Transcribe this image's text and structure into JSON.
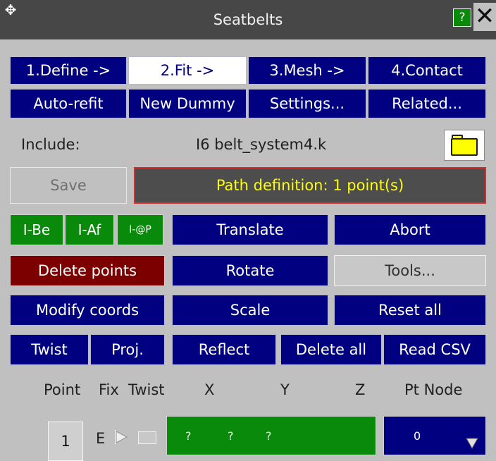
{
  "window": {
    "title": "Seatbelts",
    "pin_glyph": "✥",
    "help_label": "?",
    "close_label": "✕"
  },
  "steps": [
    {
      "label": "1.Define ->",
      "active": false
    },
    {
      "label": "2.Fit ->",
      "active": true
    },
    {
      "label": "3.Mesh ->",
      "active": false
    },
    {
      "label": "4.Contact",
      "active": false
    }
  ],
  "actions_row": {
    "auto_refit": "Auto-refit",
    "new_dummy": "New Dummy",
    "settings": "Settings...",
    "related": "Related..."
  },
  "include": {
    "label": "Include:",
    "value": "I6  belt_system4.k",
    "folder_icon": "folder-icon"
  },
  "save_label": "Save",
  "status_text": "Path definition: 1 point(s)",
  "insert_buttons": {
    "before": "I-Be",
    "after": "I-Af",
    "at": "I-@P"
  },
  "transform": {
    "translate": "Translate",
    "abort": "Abort",
    "delete_points": "Delete points",
    "rotate": "Rotate",
    "tools": "Tools...",
    "modify_coords": "Modify coords",
    "scale": "Scale",
    "reset_all": "Reset all",
    "twist": "Twist",
    "proj": "Proj.",
    "reflect": "Reflect",
    "delete_all": "Delete all",
    "read_csv": "Read CSV"
  },
  "table": {
    "headers": {
      "point": "Point",
      "fix": "Fix",
      "twist": "Twist",
      "x": "X",
      "y": "Y",
      "z": "Z",
      "pt_node": "Pt Node"
    },
    "rows": [
      {
        "point": "1",
        "fix": "E",
        "x": "?",
        "y": "?",
        "z": "?",
        "node": "0"
      }
    ]
  },
  "colors": {
    "navy": "#000080",
    "green": "#0a8a0a",
    "dark_red": "#7d0000",
    "status_text": "#ffff00",
    "status_border": "#d23030"
  }
}
